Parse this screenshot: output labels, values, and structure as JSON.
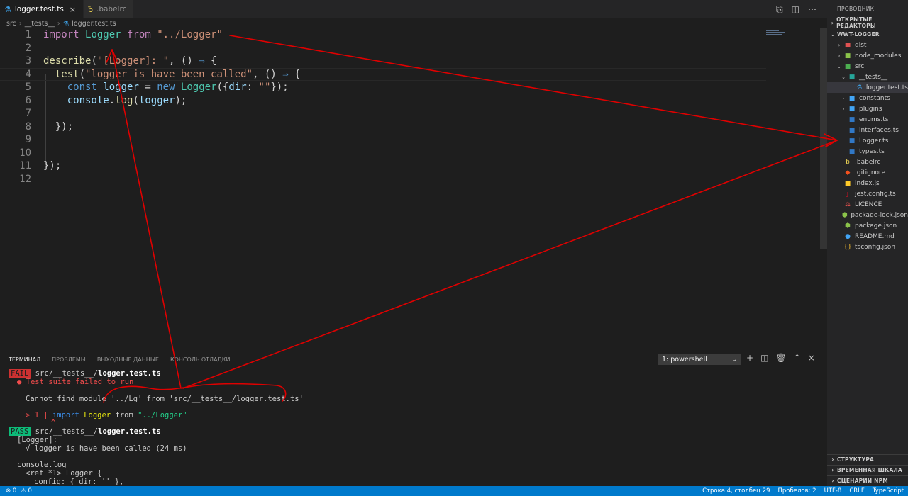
{
  "tabs": [
    {
      "label": "logger.test.ts",
      "icon": "flask-icon",
      "active": true,
      "close": "×"
    },
    {
      "label": ".babelrc",
      "icon": "babel-icon",
      "active": false
    }
  ],
  "breadcrumb": [
    "src",
    "__tests__",
    "logger.test.ts"
  ],
  "editor": {
    "line_numbers": [
      "1",
      "2",
      "3",
      "4",
      "5",
      "6",
      "7",
      "8",
      "9",
      "10",
      "11",
      "12"
    ]
  },
  "panel": {
    "tabs": [
      "ТЕРМИНАЛ",
      "ПРОБЛЕМЫ",
      "ВЫХОДНЫЕ ДАННЫЕ",
      "КОНСОЛЬ ОТЛАДКИ"
    ],
    "terminal_select": "1: powershell",
    "terminal": {
      "fail_badge": "FAIL",
      "fail_path": "src/__tests__/",
      "fail_file": "logger.test.ts",
      "suite_failed": "● Test suite failed to run",
      "cannot_find": "Cannot find module '../Lg' from 'src/__tests__/logger.test.ts'",
      "err_marker": "> 1 |",
      "err_import": "import",
      "err_logger": "Logger",
      "err_from": "from",
      "err_path": "\"../Logger\"",
      "caret": "^",
      "pass_badge": "PASS",
      "pass_path": "src/__tests__/",
      "pass_file": "logger.test.ts",
      "describe_label": "[Logger]:",
      "test_result": "√ logger is have been called (24 ms)",
      "console_log": "console.log",
      "ref_line": "<ref *1> Logger {",
      "config_line": "config: { dir: '' },"
    }
  },
  "sidebar": {
    "title": "ПРОВОДНИК",
    "open_editors": "ОТКРЫТЫЕ РЕДАКТОРЫ",
    "project": "WWT-LOGGER",
    "tree": [
      {
        "label": "dist",
        "icon": "folder-icon",
        "chev": "›"
      },
      {
        "label": "node_modules",
        "icon": "folder-icon",
        "chev": "›"
      },
      {
        "label": "src",
        "icon": "folder-icon",
        "chev": "⌄"
      },
      {
        "label": "__tests__",
        "icon": "folder-icon",
        "chev": "⌄"
      },
      {
        "label": "logger.test.ts",
        "icon": "flask-icon",
        "chev": ""
      },
      {
        "label": "constants",
        "icon": "folder-icon",
        "chev": "›"
      },
      {
        "label": "plugins",
        "icon": "folder-icon",
        "chev": "›"
      },
      {
        "label": "enums.ts",
        "icon": "ts-icon",
        "chev": ""
      },
      {
        "label": "interfaces.ts",
        "icon": "ts-icon",
        "chev": ""
      },
      {
        "label": "Logger.ts",
        "icon": "ts-icon",
        "chev": ""
      },
      {
        "label": "types.ts",
        "icon": "ts-icon",
        "chev": ""
      },
      {
        "label": ".babelrc",
        "icon": "babel-icon",
        "chev": ""
      },
      {
        "label": ".gitignore",
        "icon": "git-icon",
        "chev": ""
      },
      {
        "label": "index.js",
        "icon": "js-icon",
        "chev": ""
      },
      {
        "label": "jest.config.ts",
        "icon": "jest-icon",
        "chev": ""
      },
      {
        "label": "LICENCE",
        "icon": "license-icon",
        "chev": ""
      },
      {
        "label": "package-lock.json",
        "icon": "node-icon",
        "chev": ""
      },
      {
        "label": "package.json",
        "icon": "node-icon",
        "chev": ""
      },
      {
        "label": "README.md",
        "icon": "info-icon",
        "chev": ""
      },
      {
        "label": "tsconfig.json",
        "icon": "json-icon",
        "chev": ""
      }
    ],
    "outline": "СТРУКТУРА",
    "timeline": "ВРЕМЕННАЯ ШКАЛА",
    "npm": "СЦЕНАРИИ NPM"
  },
  "statusbar": {
    "errors": "⊗ 0",
    "warnings": "⚠ 0",
    "position": "Строка 4, столбец 29",
    "spaces": "Пробелов: 2",
    "encoding": "UTF-8",
    "eol": "CRLF",
    "language": "TypeScript"
  },
  "colors": {
    "accent": "#007acc",
    "annotation": "#e00000"
  }
}
